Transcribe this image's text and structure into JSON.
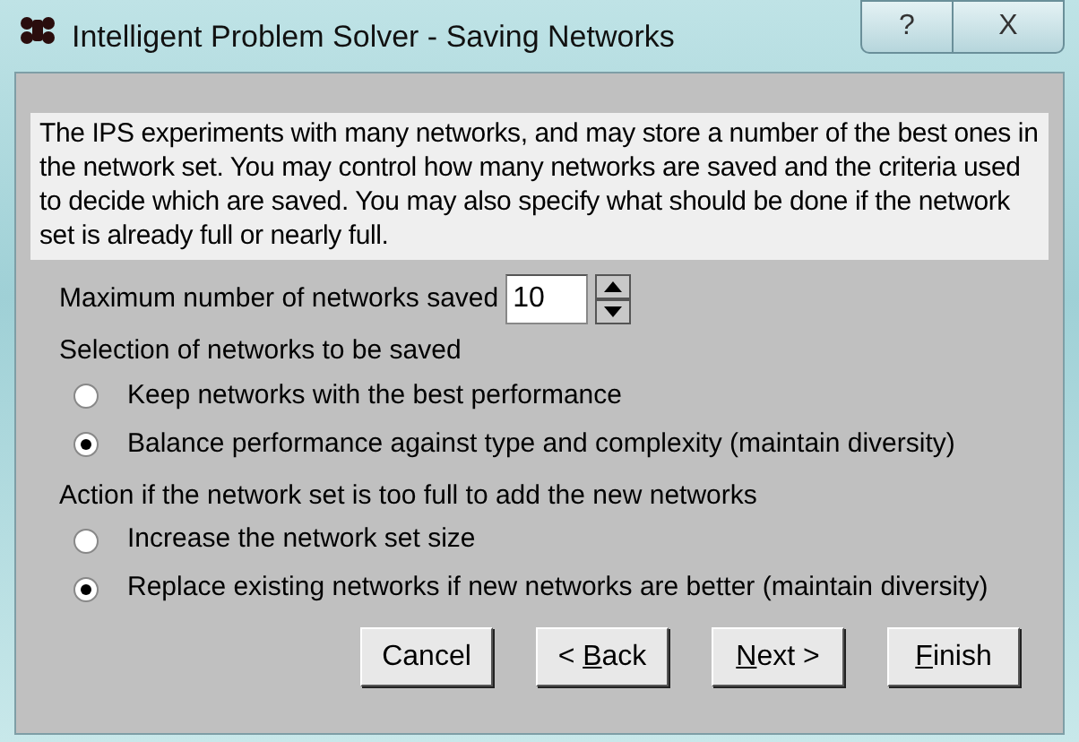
{
  "window": {
    "title": "Intelligent Problem Solver - Saving Networks",
    "controls": [
      "?",
      "X"
    ]
  },
  "description": "The IPS experiments with many networks, and may store a number of the best ones in the network set. You may control how many networks are saved and the criteria used to decide which are saved. You may also specify what should be done if the network set is already full or nearly full.",
  "max_saved": {
    "label": "Maximum number of networks saved",
    "value": "10"
  },
  "groups": [
    {
      "label": "Selection of networks to be saved",
      "options": [
        {
          "label": "Keep networks with the best performance",
          "selected": false
        },
        {
          "label": "Balance performance against type and complexity (maintain diversity)",
          "selected": true
        }
      ]
    },
    {
      "label": "Action if the network set is too full to add the new networks",
      "options": [
        {
          "label": "Increase the network set size",
          "selected": false
        },
        {
          "label": "Replace existing networks if new networks are better (maintain diversity)",
          "selected": true
        }
      ]
    }
  ],
  "buttons": [
    {
      "before": "Cancel"
    },
    {
      "before": "< ",
      "mnemonic": "B",
      "after": "ack"
    },
    {
      "mnemonic": "N",
      "after": "ext >"
    },
    {
      "mnemonic": "F",
      "after": "inish"
    }
  ]
}
